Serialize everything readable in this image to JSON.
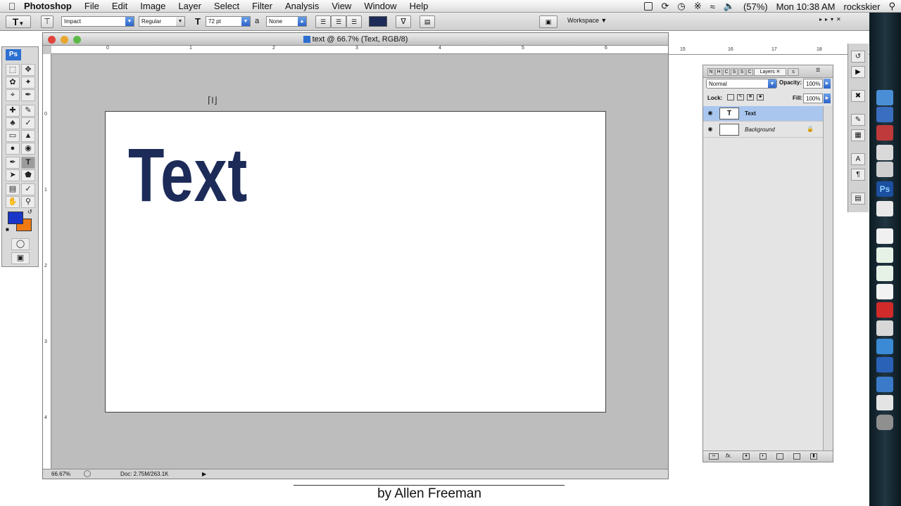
{
  "menubar": {
    "app_name": "Photoshop",
    "menus": [
      "File",
      "Edit",
      "Image",
      "Layer",
      "Select",
      "Filter",
      "Analysis",
      "View",
      "Window",
      "Help"
    ],
    "battery": "(57%)",
    "clock": "Mon 10:38 AM",
    "user": "rockskier"
  },
  "options_bar": {
    "font_family": "Impact",
    "font_style": "Regular",
    "font_size": "72 pt",
    "antialias_label": "a",
    "antialias": "None",
    "text_color": "#1c2b58",
    "workspace_label": "Workspace"
  },
  "tools": {
    "logo": "Ps",
    "foreground_color": "#1a36c8",
    "background_color": "#f07a14"
  },
  "document": {
    "title": "text @ 66.7% (Text, RGB/8)",
    "canvas_text": "Text",
    "zoom": "66.67%",
    "doc_size": "Doc: 2.75M/263.1K",
    "ruler_top_labels": [
      "0",
      "1",
      "2",
      "3",
      "4",
      "5",
      "6"
    ],
    "ruler_left_labels": [
      "0",
      "1",
      "2",
      "3",
      "4"
    ],
    "ruler_right_labels": [
      "15",
      "16",
      "17",
      "18"
    ]
  },
  "layers_panel": {
    "tab_letters": [
      "N",
      "H",
      "C",
      "S",
      "S",
      "C"
    ],
    "active_tab": "Layers",
    "last_tab_letter": "s",
    "blend_mode": "Normal",
    "opacity_label": "Opacity:",
    "opacity": "100%",
    "lock_label": "Lock:",
    "fill_label": "Fill:",
    "fill": "100%",
    "layers": [
      {
        "name": "Text",
        "thumb": "T",
        "selected": true
      },
      {
        "name": "Background",
        "thumb": "",
        "selected": false
      }
    ]
  },
  "caption": "by Allen Freeman"
}
